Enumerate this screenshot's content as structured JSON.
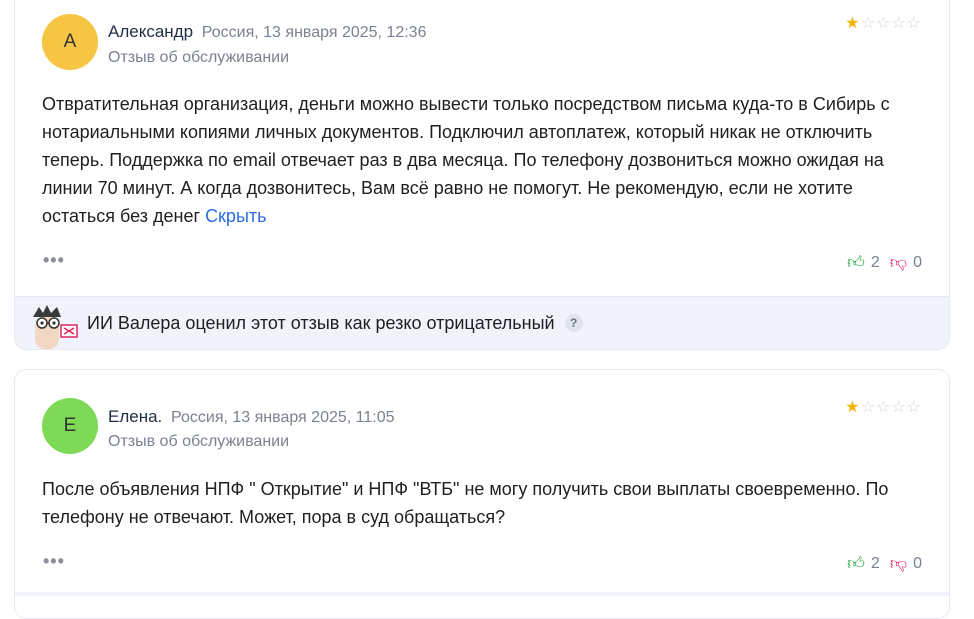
{
  "reviews": [
    {
      "avatar_letter": "А",
      "avatar_color": "#f7c544",
      "author": "Александр",
      "meta": "Россия, 13 января 2025, 12:36",
      "type": "Отзыв об обслуживании",
      "rating": 1,
      "rating_max": 5,
      "text": "Отвратительная организация, деньги можно вывести только посредством письма куда-то в Сибирь с нотариальными копиями личных документов. Подключил автоплатеж, который никак не отключить теперь. Поддержка по email отвечает раз в два месяца. По телефону дозвониться можно ожидая на линии 70 минут. А когда дозвонитесь, Вам всё равно не помогут. Не рекомендую, если не хотите остаться без денег",
      "toggle_label": "Скрыть",
      "more_label": "•••",
      "likes": "2",
      "dislikes": "0",
      "ai_text": "ИИ Валера оценил этот отзыв как резко отрицательный",
      "help_label": "?"
    },
    {
      "avatar_letter": "Е",
      "avatar_color": "#7ed957",
      "author": "Елена.",
      "meta": "Россия, 13 января 2025, 11:05",
      "type": "Отзыв об обслуживании",
      "rating": 1,
      "rating_max": 5,
      "text": "После объявления НПФ \" Открытие\" и НПФ \"ВТБ\" не могу получить свои выплаты своевременно. По телефону не отвечают. Может, пора в суд обращаться?",
      "more_label": "•••",
      "likes": "2",
      "dislikes": "0"
    }
  ]
}
